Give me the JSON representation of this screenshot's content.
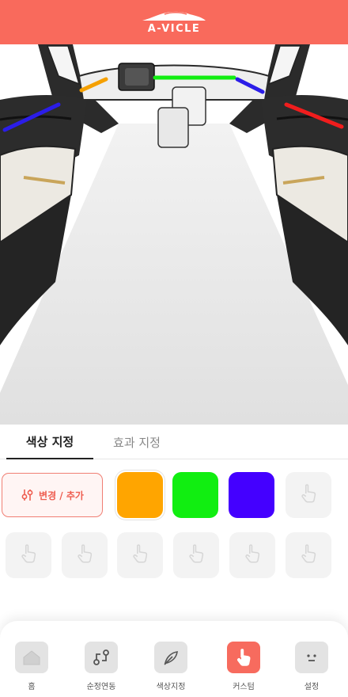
{
  "app": {
    "logo_text": "A-VICLE",
    "brand_color": "#f96a5c"
  },
  "interior": {
    "ambient_lights": [
      {
        "zone": "front-left-door",
        "color": "#2b1de8"
      },
      {
        "zone": "dash-left",
        "color": "#f5a000"
      },
      {
        "zone": "dash-center",
        "color": "#12ee12"
      },
      {
        "zone": "dash-right",
        "color": "#2b1de8"
      },
      {
        "zone": "front-right-door",
        "color": "#f01d1d"
      }
    ]
  },
  "tabs": {
    "color": "색상 지정",
    "effect": "효과 지정",
    "active": "color"
  },
  "palette": {
    "change_label": "변경 / 추가",
    "colors": [
      {
        "hex": "#ffa500",
        "selected": true
      },
      {
        "hex": "#11ee11",
        "selected": false
      },
      {
        "hex": "#4400ff",
        "selected": false
      }
    ],
    "empty_slot_icon": "touch-hand-icon"
  },
  "nav": {
    "active": "custom",
    "items": [
      {
        "id": "home",
        "label": "홈",
        "icon": "home-icon"
      },
      {
        "id": "sync",
        "label": "순정연동",
        "icon": "sync-arrows-icon"
      },
      {
        "id": "color",
        "label": "색상지정",
        "icon": "feather-icon"
      },
      {
        "id": "custom",
        "label": "커스텀",
        "icon": "touch-hand-icon"
      },
      {
        "id": "settings",
        "label": "설정",
        "icon": "face-icon"
      }
    ]
  }
}
